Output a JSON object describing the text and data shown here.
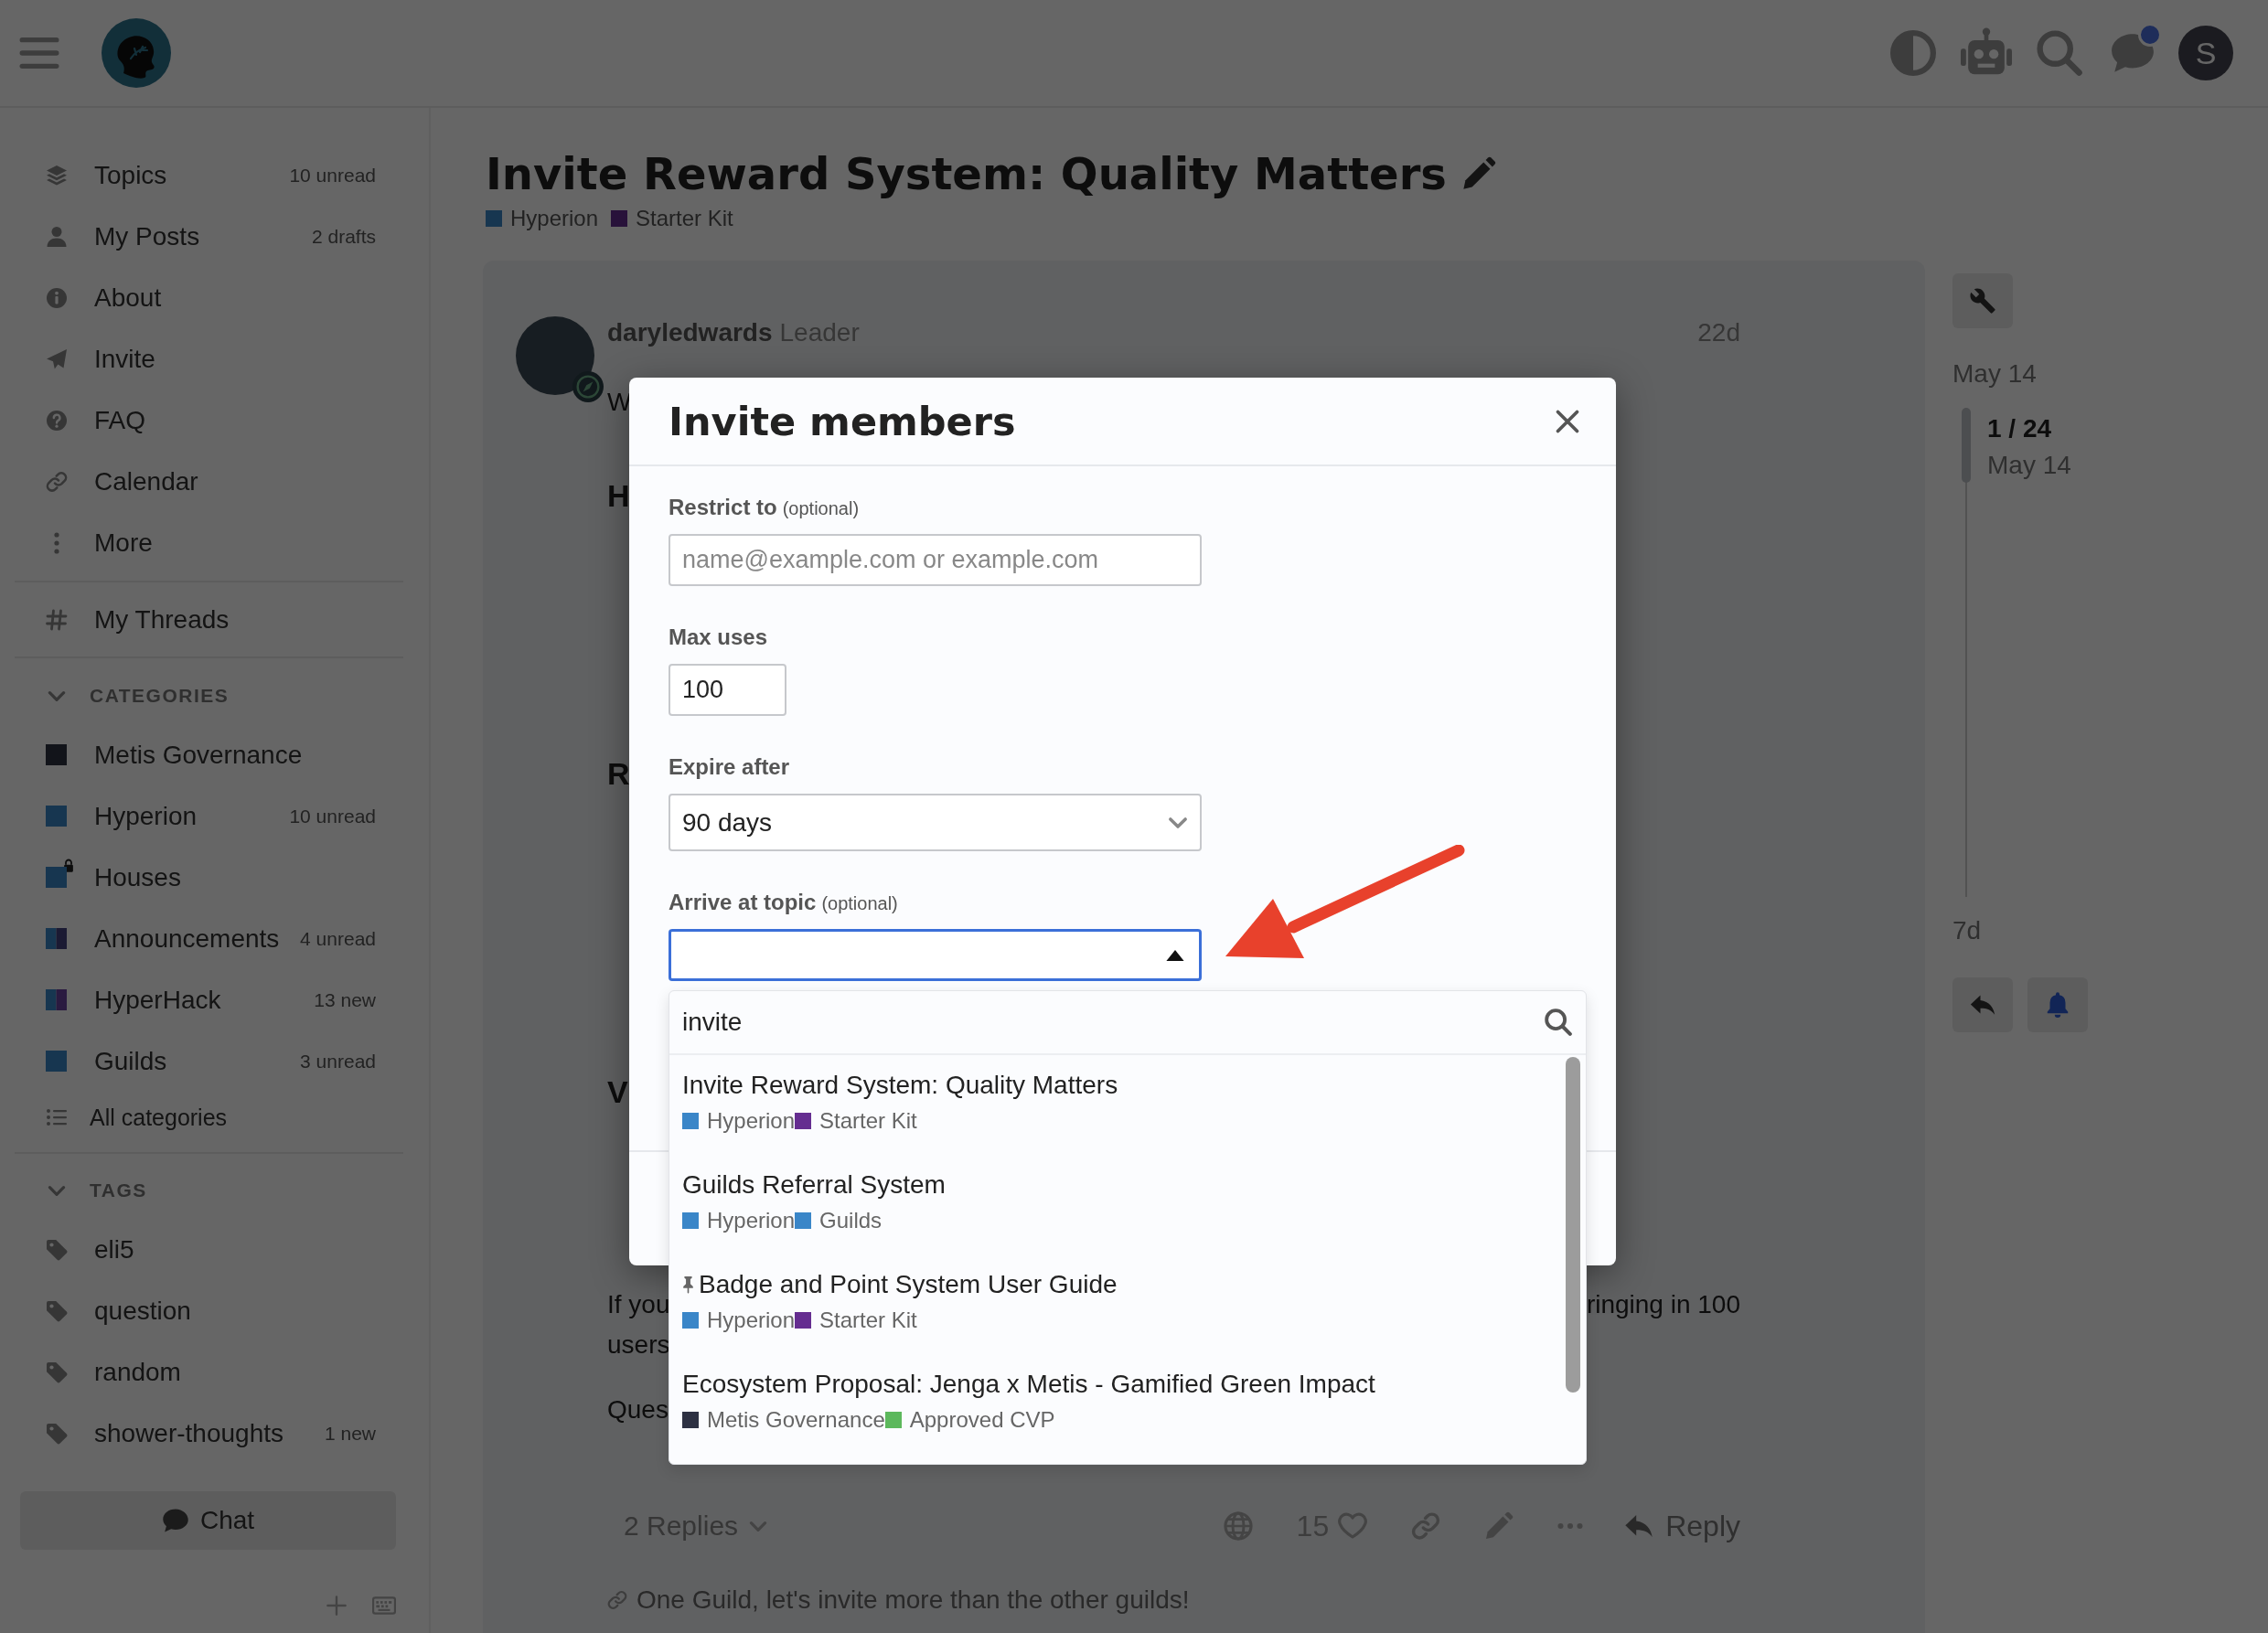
{
  "header": {
    "avatar_letter": "S",
    "chat_unread": true
  },
  "sidebar": {
    "nav": [
      {
        "label": "Topics",
        "count": "10 unread"
      },
      {
        "label": "My Posts",
        "count": "2 drafts"
      },
      {
        "label": "About"
      },
      {
        "label": "Invite"
      },
      {
        "label": "FAQ"
      },
      {
        "label": "Calendar"
      },
      {
        "label": "More"
      }
    ],
    "threads": "My Threads",
    "categories": {
      "title": "CATEGORIES",
      "expanded": true,
      "items": [
        {
          "label": "Metis Governance",
          "color": "#12141a",
          "locked": false
        },
        {
          "label": "Hyperion",
          "color": "#173650",
          "count": "10 unread",
          "locked": false
        },
        {
          "label": "Houses",
          "color": "#173650",
          "locked": true
        },
        {
          "label": "Announcements",
          "parent": {
            "color": "#173650"
          },
          "color": "#1b1a33",
          "count": "4 unread",
          "locked": false
        },
        {
          "label": "HyperHack",
          "parent": {
            "color": "#173650"
          },
          "color": "#2a1a40",
          "count": "13 new",
          "locked": false
        },
        {
          "label": "Guilds",
          "color": "#173650",
          "count": "3 unread",
          "locked": false
        }
      ],
      "all": "All categories"
    },
    "tags": {
      "title": "TAGS",
      "expanded": true,
      "items": [
        {
          "label": "eli5"
        },
        {
          "label": "question"
        },
        {
          "label": "random"
        },
        {
          "label": "shower-thoughts",
          "count": "1 new"
        }
      ]
    },
    "chat": "Chat"
  },
  "topic": {
    "title": "Invite Reward System: Quality Matters",
    "categories": [
      {
        "name": "Hyperion",
        "color": "#173650"
      },
      {
        "name": "Starter Kit",
        "color": "#28123a"
      }
    ]
  },
  "post": {
    "username": "daryledwards",
    "user_title": "Leader",
    "age": "22d",
    "visible_text": [
      {
        "kind": "text",
        "left": "W"
      },
      {
        "kind": "heading",
        "left": "H"
      },
      {
        "kind": "heading",
        "left": "R"
      },
      {
        "kind": "heading",
        "left": "V"
      },
      {
        "kind": "text",
        "left": "If you",
        "right": "ringing in 100"
      },
      {
        "kind": "text",
        "left": "users"
      },
      {
        "kind": "text",
        "left": "Ques"
      }
    ],
    "replies": "2 Replies",
    "likes": "15",
    "reply": "Reply",
    "linked_topic": "One Guild, let's invite more than the other guilds!"
  },
  "timeline": {
    "start": "May 14",
    "position": "1 / 24",
    "position_date": "May 14",
    "end": "7d",
    "bell_active": true
  },
  "modal": {
    "title": "Invite members",
    "fields": [
      {
        "kind": "text",
        "label": "Restrict to",
        "note": "(optional)",
        "placeholder": "name@example.com or example.com"
      },
      {
        "kind": "number",
        "label": "Max uses",
        "value": "100"
      },
      {
        "kind": "select",
        "label": "Expire after",
        "value": "90 days"
      },
      {
        "kind": "combobox",
        "label": "Arrive at topic",
        "note": "(optional)",
        "expanded": true,
        "filter": "invite",
        "options": [
          {
            "title": "Invite Reward System: Quality Matters",
            "pinned": false,
            "categories": [
              {
                "name": "Hyperion",
                "color": "#3a86c8"
              },
              {
                "name": "Starter Kit",
                "color": "#652d90"
              }
            ]
          },
          {
            "title": "Guilds Referral System",
            "pinned": false,
            "categories": [
              {
                "name": "Hyperion",
                "color": "#3a86c8"
              },
              {
                "name": "Guilds",
                "color": "#3a86c8"
              }
            ]
          },
          {
            "title": "Badge and Point System User Guide",
            "pinned": true,
            "categories": [
              {
                "name": "Hyperion",
                "color": "#3a86c8"
              },
              {
                "name": "Starter Kit",
                "color": "#652d90"
              }
            ]
          },
          {
            "title": "Ecosystem Proposal: Jenga x Metis - Gamified Green Impact",
            "pinned": false,
            "categories": [
              {
                "name": "Metis Governance",
                "color": "#2e3142"
              },
              {
                "name": "Approved CVP",
                "color": "#5cb85c"
              }
            ]
          }
        ]
      }
    ]
  }
}
